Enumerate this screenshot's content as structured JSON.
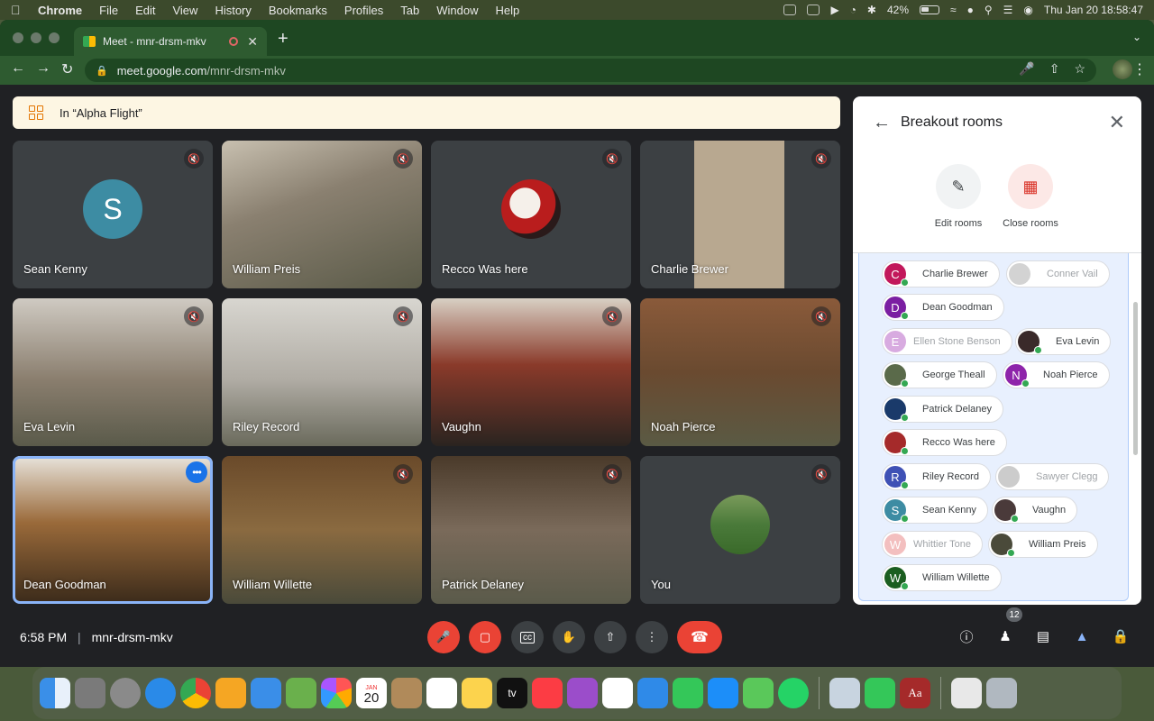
{
  "menubar": {
    "app": "Chrome",
    "items": [
      "File",
      "Edit",
      "View",
      "History",
      "Bookmarks",
      "Profiles",
      "Tab",
      "Window",
      "Help"
    ],
    "battery": "42%",
    "datetime": "Thu Jan 20  18:58:47"
  },
  "browser": {
    "tab_title": "Meet - mnr-drsm-mkv",
    "url_host": "meet.google.com",
    "url_path": "/mnr-drsm-mkv"
  },
  "meet": {
    "banner": "In “Alpha Flight”",
    "time": "6:58 PM",
    "separator": "|",
    "meeting_code": "mnr-drsm-mkv",
    "participant_count": "12",
    "tiles": [
      {
        "name": "Sean Kenny",
        "initial": "S",
        "avatar_color": "#3d8ca3"
      },
      {
        "name": "William Preis"
      },
      {
        "name": "Recco Was here"
      },
      {
        "name": "Charlie Brewer"
      },
      {
        "name": "Eva Levin"
      },
      {
        "name": "Riley Record"
      },
      {
        "name": "Vaughn"
      },
      {
        "name": "Noah Pierce"
      },
      {
        "name": "Dean Goodman"
      },
      {
        "name": "William Willette"
      },
      {
        "name": "Patrick Delaney"
      },
      {
        "name": "You"
      }
    ]
  },
  "panel": {
    "title": "Breakout rooms",
    "edit_label": "Edit rooms",
    "close_label": "Close rooms",
    "participants": [
      {
        "name": "Charlie Brewer",
        "initial": "C",
        "color": "#c2185b",
        "online": true
      },
      {
        "name": "Conner Vail",
        "initial": "",
        "color": "#9e9e9e",
        "online": false
      },
      {
        "name": "Dean Goodman",
        "initial": "D",
        "color": "#7b1fa2",
        "online": true
      },
      {
        "name": "Ellen Stone Benson",
        "initial": "E",
        "color": "#ab47bc",
        "online": false
      },
      {
        "name": "Eva Levin",
        "initial": "",
        "color": "#3a2a2a",
        "online": true
      },
      {
        "name": "George Theall",
        "initial": "",
        "color": "#5a6a4a",
        "online": true
      },
      {
        "name": "Noah Pierce",
        "initial": "N",
        "color": "#8e24aa",
        "online": true
      },
      {
        "name": "Patrick Delaney",
        "initial": "",
        "color": "#1a3a6a",
        "online": true
      },
      {
        "name": "Recco Was here",
        "initial": "",
        "color": "#a52a2a",
        "online": true
      },
      {
        "name": "Riley Record",
        "initial": "R",
        "color": "#3f51b5",
        "online": true
      },
      {
        "name": "Sawyer Clegg",
        "initial": "",
        "color": "#8e8e8e",
        "online": false
      },
      {
        "name": "Sean Kenny",
        "initial": "S",
        "color": "#3d8ca3",
        "online": true
      },
      {
        "name": "Vaughn",
        "initial": "",
        "color": "#4a3a3a",
        "online": true
      },
      {
        "name": "Whittier Tone",
        "initial": "W",
        "color": "#e57373",
        "online": false
      },
      {
        "name": "William Preis",
        "initial": "",
        "color": "#4a4a3a",
        "online": true
      },
      {
        "name": "William Willette",
        "initial": "W",
        "color": "#1b5e20",
        "online": true
      }
    ]
  },
  "dock": {
    "calendar_month": "JAN",
    "calendar_day": "20",
    "tv_label": "tv",
    "dictionary_label": "Aa"
  }
}
